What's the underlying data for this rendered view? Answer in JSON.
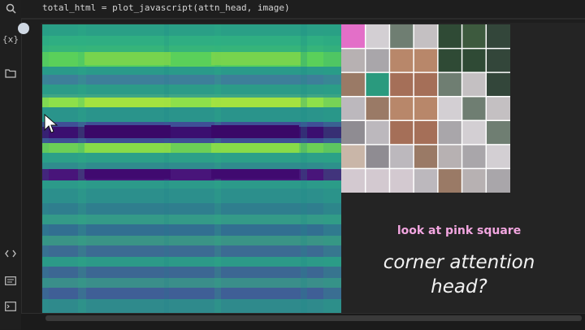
{
  "code": {
    "text": "total_html = plot_javascript(attn_head, image)"
  },
  "sidebar": {
    "icons": [
      "search-icon",
      "variables-icon",
      "folder-icon",
      "code-icon",
      "terminal-list-icon",
      "terminal-icon"
    ],
    "variables_label": "{x}"
  },
  "captions": {
    "highlight": "look at pink square",
    "question_line1": "corner attention",
    "question_line2": "head?"
  },
  "colors": {
    "highlight_pink": "#e36fc8",
    "selected_teal": "#2a9a7e",
    "caption_pink": "#f2a6e0",
    "heatmap_base": "#27a088"
  }
}
